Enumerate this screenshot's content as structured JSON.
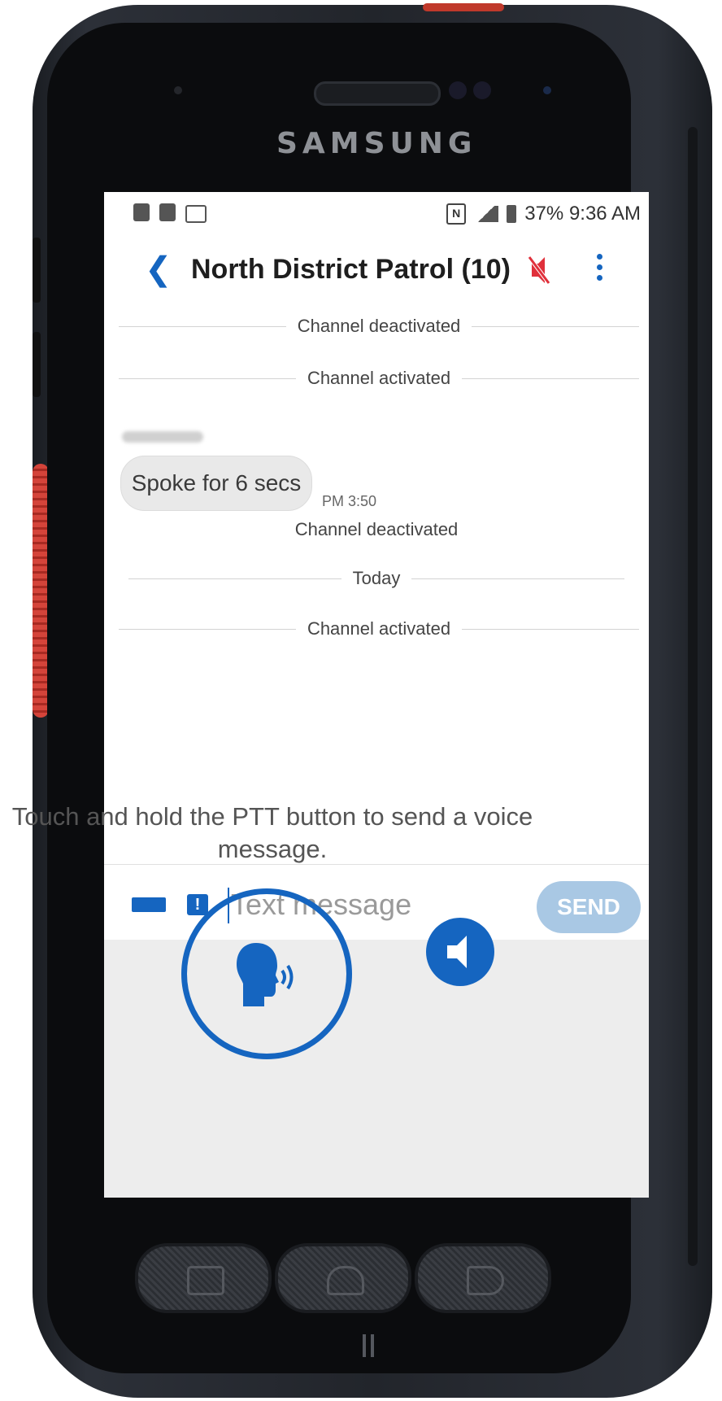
{
  "device": {
    "brand": "SAMSUNG"
  },
  "statusbar": {
    "nfc_label": "N",
    "right_text": "37% 9:36 AM"
  },
  "appbar": {
    "title": "North District Patrol (10)"
  },
  "chat": {
    "dividers": [
      "Channel deactivated",
      "Channel activated",
      "Channel deactivated",
      "Today",
      "Channel activated"
    ],
    "message": {
      "bubble_text": "Spoke for 6 secs",
      "time": "PM 3:50"
    }
  },
  "composer": {
    "placeholder": "Text message",
    "send_label": "SEND"
  },
  "ptt": {
    "hint": "Touch and hold the PTT button to send a voice message."
  },
  "colors": {
    "accent": "#1565c0",
    "send_disabled": "#a9c8e4",
    "mute_icon": "#e0303b"
  }
}
